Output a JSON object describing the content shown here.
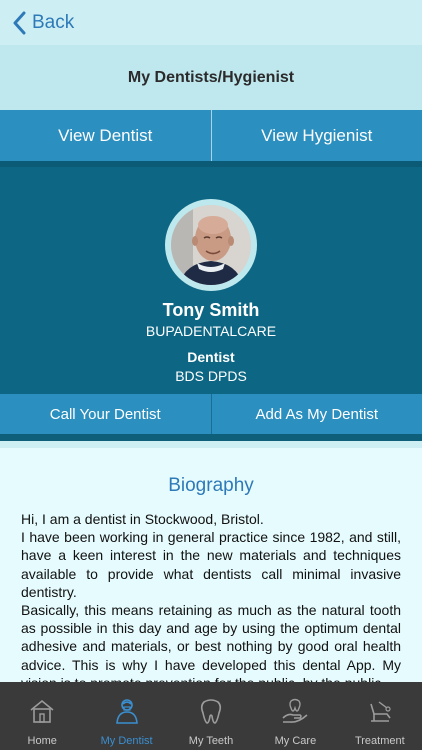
{
  "nav": {
    "back_label": "Back"
  },
  "header": {
    "title": "My Dentists/Hygienist"
  },
  "tabs": [
    {
      "label": "View Dentist"
    },
    {
      "label": "View Hygienist"
    }
  ],
  "profile": {
    "name": "Tony Smith",
    "company": "BUPADENTALCARE",
    "role": "Dentist",
    "qualifications": "BDS DPDS"
  },
  "actions": {
    "call_label": "Call Your Dentist",
    "add_label": "Add As My Dentist"
  },
  "biography": {
    "heading": "Biography",
    "text": "Hi, I am a dentist in Stockwood, Bristol.\nI have been working in general practice since 1982, and still, have a keen interest in the new materials and techniques available to provide what dentists call minimal invasive dentistry.\nBasically, this means retaining as much as the natural tooth as possible in this day and age by using the optimum dental adhesive and materials, or best nothing by good oral health advice. This is why I have developed this dental App. My vision is to promote prevention for the public, by the public."
  },
  "tabbar": {
    "items": [
      {
        "label": "Home",
        "icon": "home-icon"
      },
      {
        "label": "My Dentist",
        "icon": "dentist-icon",
        "active": true
      },
      {
        "label": "My Teeth",
        "icon": "tooth-icon"
      },
      {
        "label": "My Care",
        "icon": "care-hand-icon"
      },
      {
        "label": "Treatment",
        "icon": "dental-chair-icon"
      }
    ]
  },
  "colors": {
    "accent": "#2e7ab8",
    "tab_blue": "#2b8fbf",
    "profile_bg": "#0d6683",
    "tabbar_bg": "#3a3a3a",
    "active_tab": "#3a8fd0"
  }
}
